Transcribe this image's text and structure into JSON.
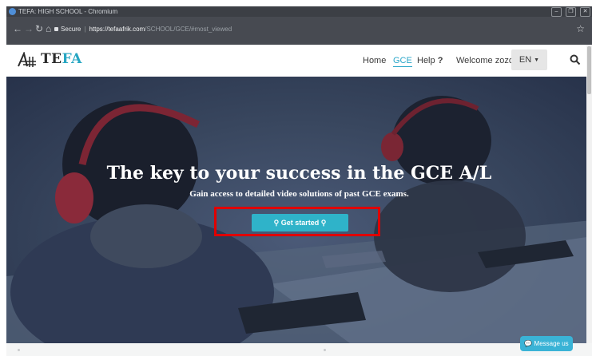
{
  "window": {
    "title": "TEFA: HIGH SCHOOL - Chromium"
  },
  "browser": {
    "secure_label": "Secure",
    "url_host": "https://tefaafrik.com",
    "url_path": "/SCHOOL/GCE/#most_viewed"
  },
  "brand": {
    "name_part1": "TE",
    "name_part2": "FA"
  },
  "nav": {
    "home": "Home",
    "gce": "GCE",
    "help": "Help",
    "help_suffix": "?",
    "welcome": "Welcome zozo",
    "lang": "EN"
  },
  "hero": {
    "title": "The key to your success in the GCE A/L",
    "subtitle": "Gain access to detailed video solutions of past GCE exams.",
    "cta": "Get started"
  },
  "chat": {
    "label": "Message us"
  },
  "colors": {
    "accent": "#2fb3c9",
    "highlight": "#e00000"
  }
}
